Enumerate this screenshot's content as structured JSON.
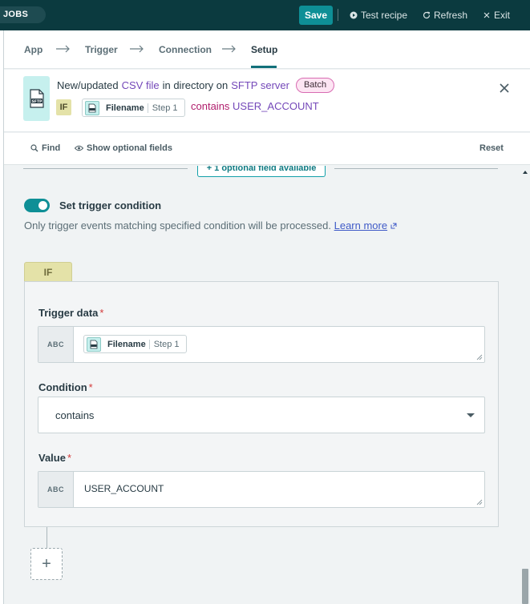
{
  "topbar": {
    "jobs_label": "JOBS",
    "save_label": "Save",
    "test_label": "Test recipe",
    "refresh_label": "Refresh",
    "exit_label": "Exit"
  },
  "steps": [
    {
      "label": "App"
    },
    {
      "label": "Trigger"
    },
    {
      "label": "Connection"
    },
    {
      "label": "Setup",
      "active": true
    }
  ],
  "summary": {
    "prefix": "New/updated",
    "file_link": "CSV file",
    "mid": "in directory on",
    "server_link": "SFTP server",
    "batch": "Batch",
    "if_badge": "IF",
    "pill_name": "Filename",
    "pill_step": "Step 1",
    "contains": "contains",
    "value": "USER_ACCOUNT",
    "app_icon": "sftp-file-icon"
  },
  "tools": {
    "find": "Find",
    "optional": "Show optional fields",
    "reset": "Reset"
  },
  "optional_button": "+ 1 optional field available",
  "condition": {
    "toggle_label": "Set trigger condition",
    "toggle_on": true,
    "hint": "Only trigger events matching specified condition will be processed.",
    "learn_more": "Learn more",
    "if_tab": "IF",
    "trigger_data_label": "Trigger data",
    "abc": "ABC",
    "trigger_pill_name": "Filename",
    "trigger_pill_step": "Step 1",
    "condition_label": "Condition",
    "condition_value": "contains",
    "value_label": "Value",
    "value_value": "USER_ACCOUNT",
    "required_mark": "*",
    "add_label": "+"
  },
  "colors": {
    "topbar": "#0b3a3f",
    "accent": "#0e8f96",
    "link": "#7448b9",
    "operator": "#b01d6c",
    "if_yellow": "#e4e2a8",
    "batch_pink": "#fde5f3"
  }
}
